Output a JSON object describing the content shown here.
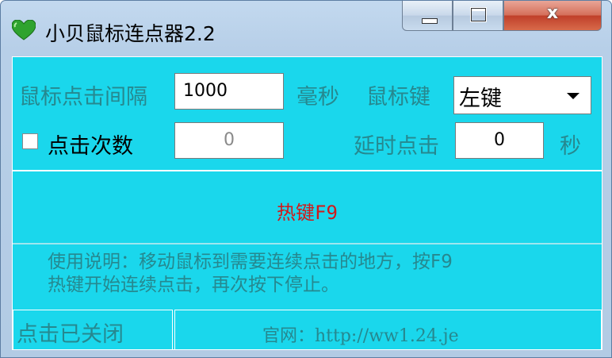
{
  "window": {
    "title": "小贝鼠标连点器2.2",
    "icon": "green-heart-icon",
    "close_glyph": "x"
  },
  "settings": {
    "interval_label": "鼠标点击间隔",
    "interval_value": "1000",
    "interval_unit": "毫秒",
    "mouse_key_label": "鼠标键",
    "mouse_key_value": "左键",
    "count_checkbox_label": "点击次数",
    "count_checked": false,
    "count_value": "0",
    "delay_label": "延时点击",
    "delay_value": "0",
    "delay_unit": "秒"
  },
  "hotkey": {
    "label": "热键F9",
    "color": "#d11a1a"
  },
  "instructions": {
    "line1": "使用说明：移动鼠标到需要连续点击的地方，按F9",
    "line2": "热键开始连续点击，再次按下停止。"
  },
  "status": {
    "state": "点击已关闭",
    "website": "官网：http://ww1.24.je"
  },
  "colors": {
    "client_background": "#1ad7ec",
    "label_text": "#26888f"
  }
}
